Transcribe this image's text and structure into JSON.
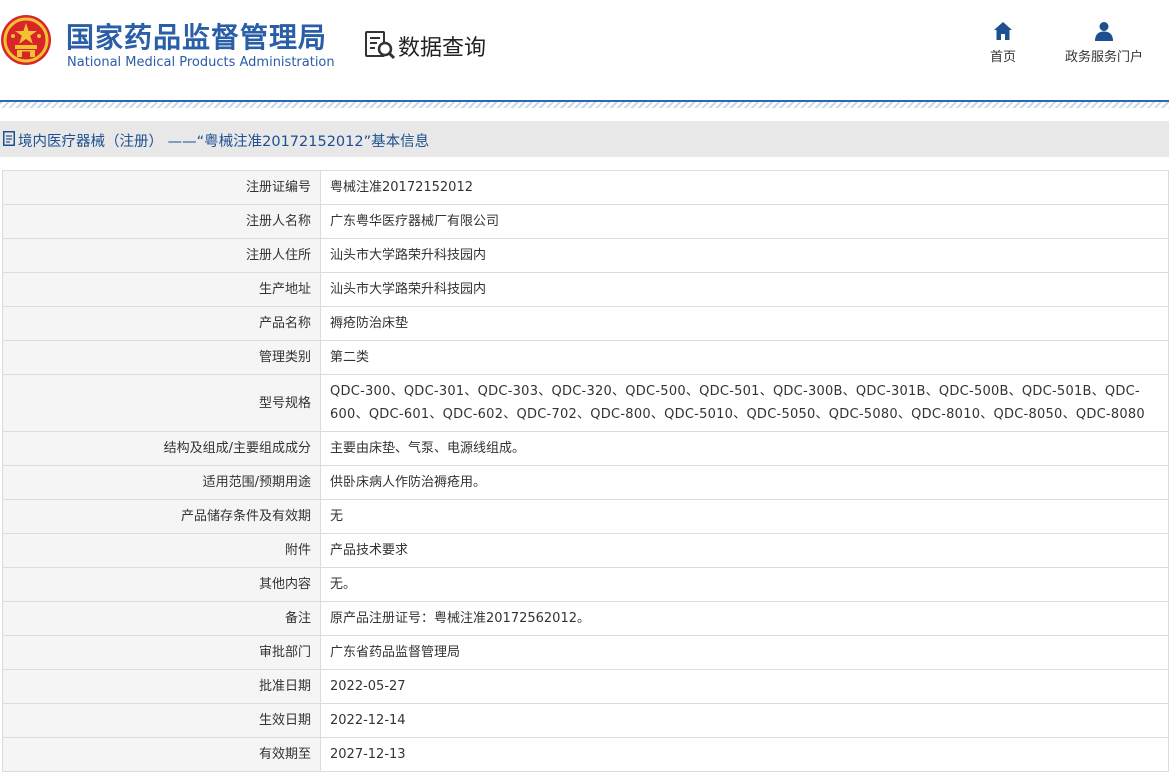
{
  "header": {
    "org_name_cn": "国家药品监督管理局",
    "org_name_en": "National Medical Products Administration",
    "query_title": "数据查询",
    "nav": [
      {
        "label": "首页",
        "icon": "home-icon"
      },
      {
        "label": "政务服务门户",
        "icon": "user-icon"
      }
    ]
  },
  "page": {
    "title": "境内医疗器械（注册） ——“粤械注准20172152012”基本信息"
  },
  "colors": {
    "brand": "#2a5ea7",
    "title_text": "#1d4f91",
    "label_bg": "#f5f5f5",
    "title_bar_bg": "#e8e8e8"
  },
  "record": [
    {
      "label": "注册证编号",
      "value": "粤械注准20172152012"
    },
    {
      "label": "注册人名称",
      "value": "广东粤华医疗器械厂有限公司"
    },
    {
      "label": "注册人住所",
      "value": "汕头市大学路荣升科技园内"
    },
    {
      "label": "生产地址",
      "value": "汕头市大学路荣升科技园内"
    },
    {
      "label": "产品名称",
      "value": "褥疮防治床垫"
    },
    {
      "label": "管理类别",
      "value": "第二类"
    },
    {
      "label": "型号规格",
      "value": "QDC-300、QDC-301、QDC-303、QDC-320、QDC-500、QDC-501、QDC-300B、QDC-301B、QDC-500B、QDC-501B、QDC-600、QDC-601、QDC-602、QDC-702、QDC-800、QDC-5010、QDC-5050、QDC-5080、QDC-8010、QDC-8050、QDC-8080"
    },
    {
      "label": "结构及组成/主要组成成分",
      "value": "主要由床垫、气泵、电源线组成。"
    },
    {
      "label": "适用范围/预期用途",
      "value": "供卧床病人作防治褥疮用。"
    },
    {
      "label": "产品储存条件及有效期",
      "value": "无"
    },
    {
      "label": "附件",
      "value": "产品技术要求"
    },
    {
      "label": "其他内容",
      "value": "无。"
    },
    {
      "label": "备注",
      "value": "原产品注册证号：粤械注准20172562012。"
    },
    {
      "label": "审批部门",
      "value": "广东省药品监督管理局"
    },
    {
      "label": "批准日期",
      "value": "2022-05-27"
    },
    {
      "label": "生效日期",
      "value": "2022-12-14"
    },
    {
      "label": "有效期至",
      "value": "2027-12-13"
    }
  ]
}
